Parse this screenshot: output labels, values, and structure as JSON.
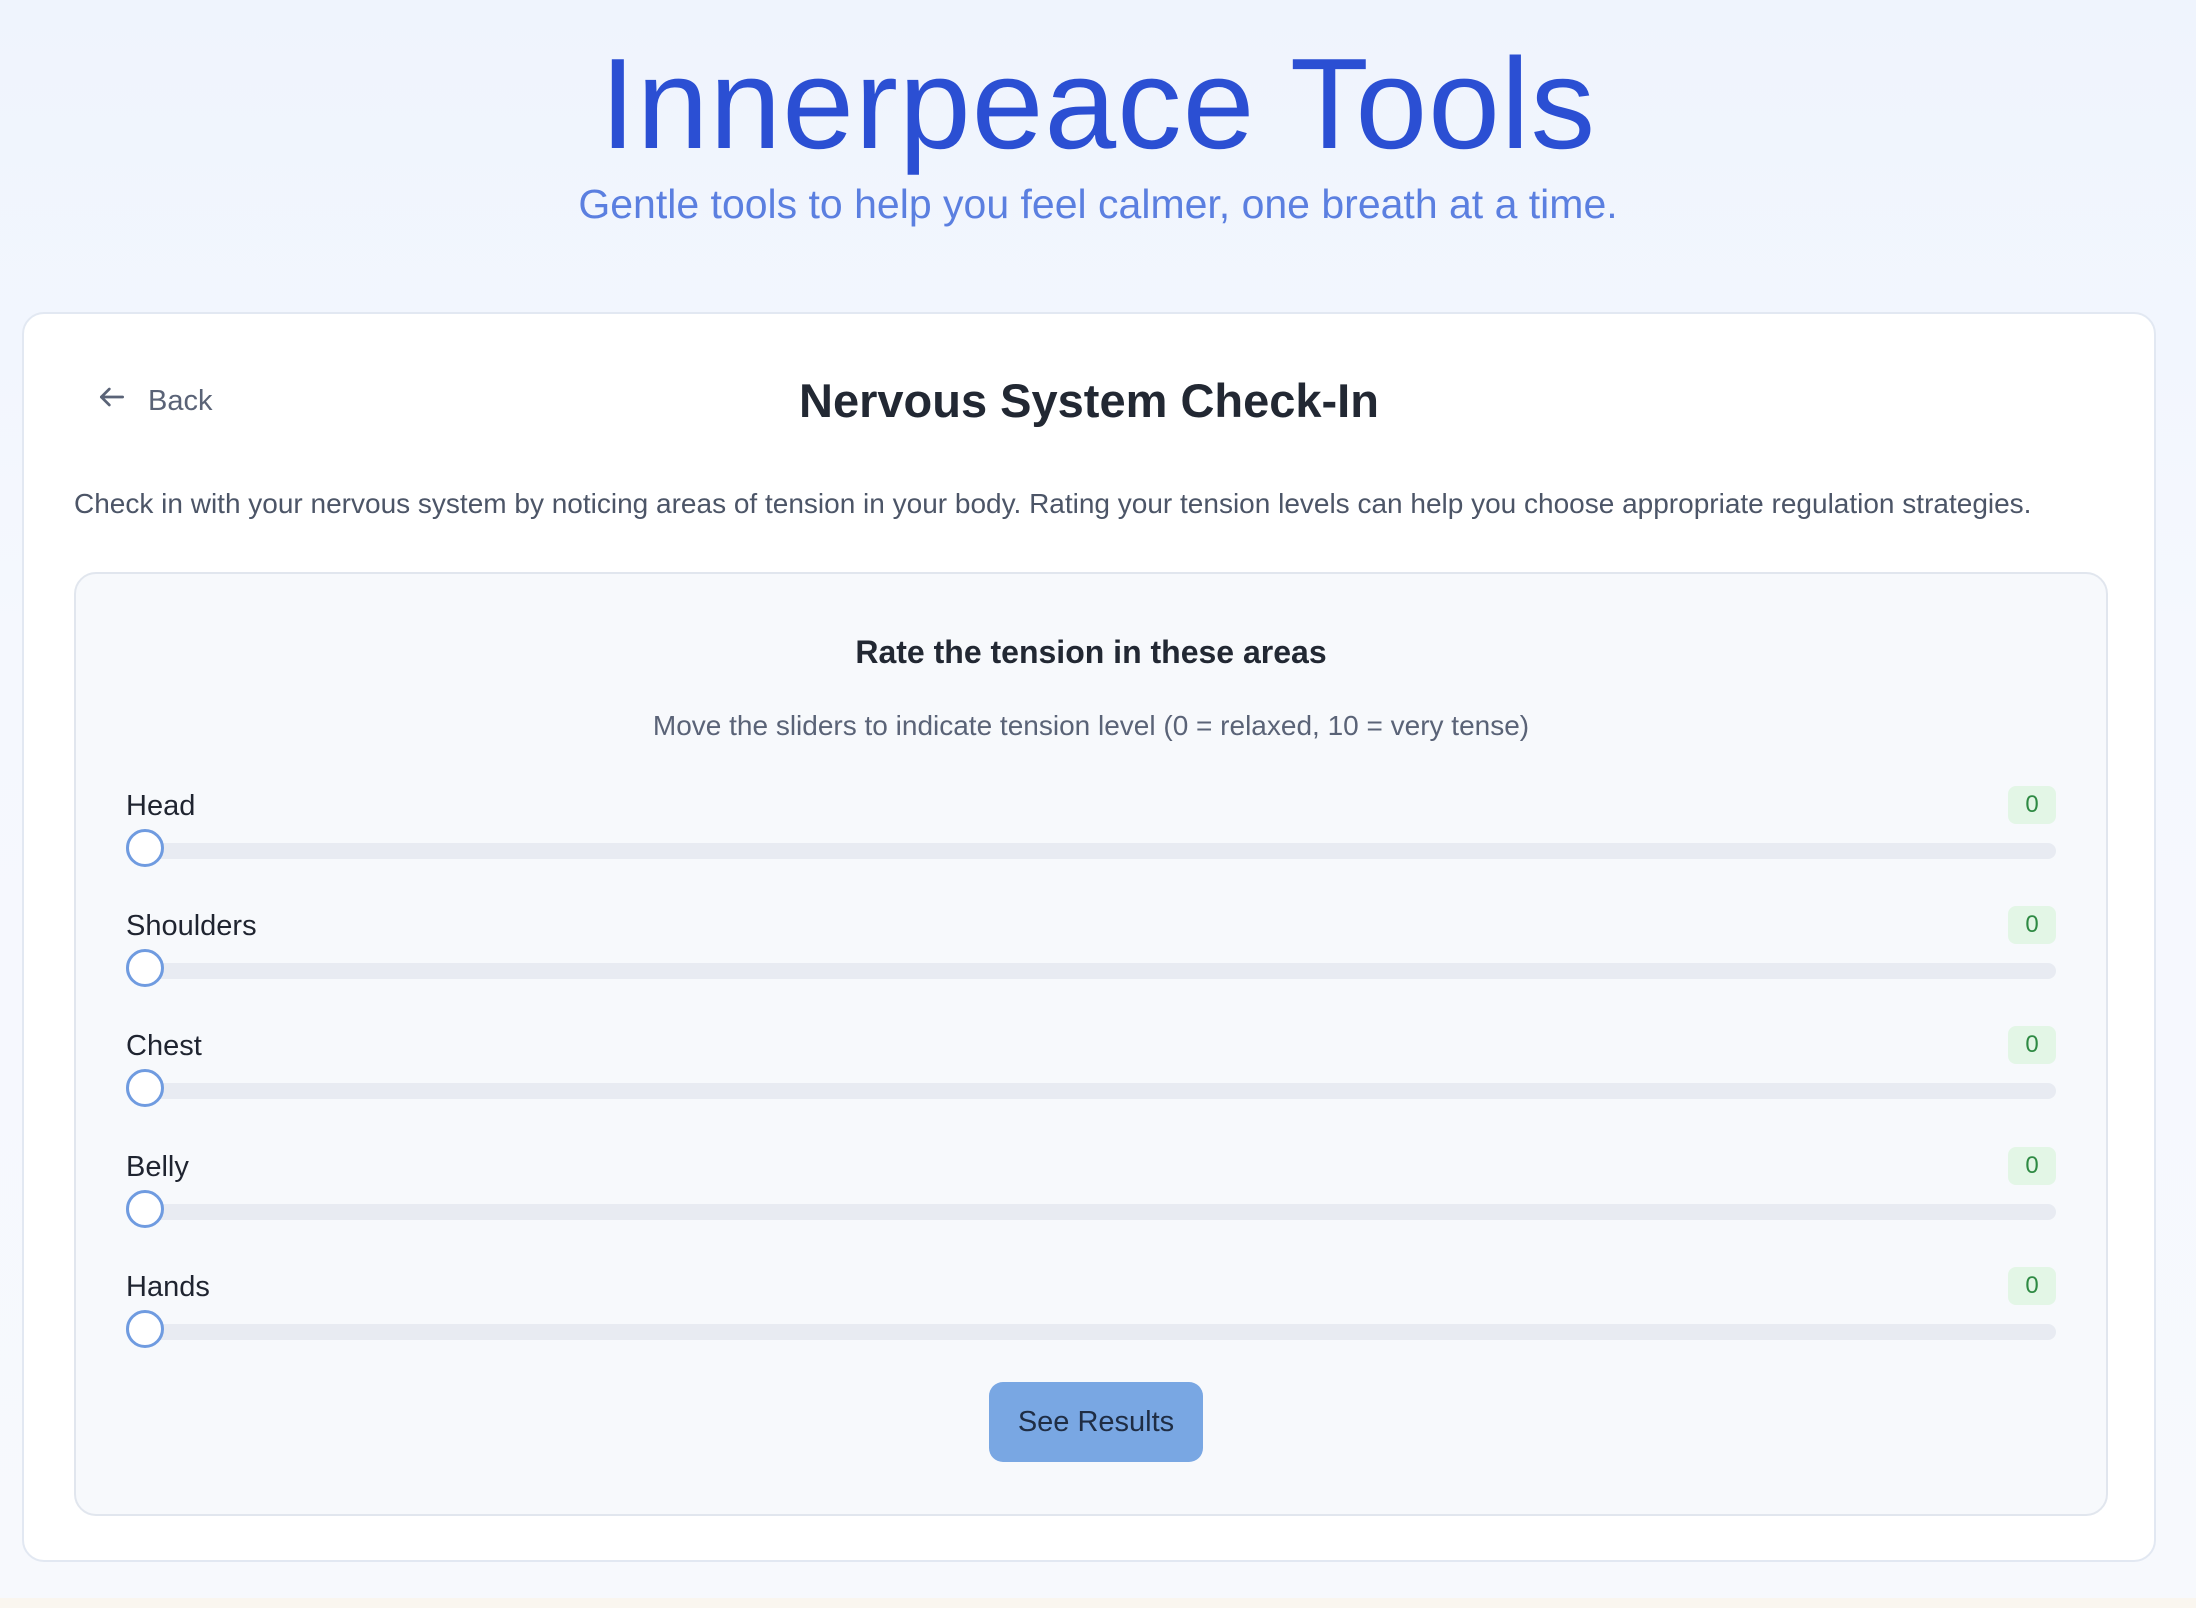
{
  "app": {
    "title": "Innerpeace Tools",
    "subtitle": "Gentle tools to help you feel calmer, one breath at a time."
  },
  "checkin": {
    "back_label": "Back",
    "title": "Nervous System Check-In",
    "intro": "Check in with your nervous system by noticing areas of tension in your body. Rating your tension levels can help you choose appropriate regulation strategies.",
    "panel_title": "Rate the tension in these areas",
    "panel_hint": "Move the sliders to indicate tension level (0 = relaxed, 10 = very tense)",
    "sliders": [
      {
        "label": "Head",
        "value": "0",
        "level": 0,
        "max": 10
      },
      {
        "label": "Shoulders",
        "value": "0",
        "level": 0,
        "max": 10
      },
      {
        "label": "Chest",
        "value": "0",
        "level": 0,
        "max": 10
      },
      {
        "label": "Belly",
        "value": "0",
        "level": 0,
        "max": 10
      },
      {
        "label": "Hands",
        "value": "0",
        "level": 0,
        "max": 10
      }
    ],
    "results_button": "See Results"
  },
  "colors": {
    "title": "#2b4fd3",
    "subtitle": "#5b7fe0",
    "accent": "#79a7e3",
    "value_badge_bg": "#e3f6e6",
    "value_badge_text": "#2f8a44"
  },
  "icons": {
    "back": "arrow-left-icon"
  }
}
